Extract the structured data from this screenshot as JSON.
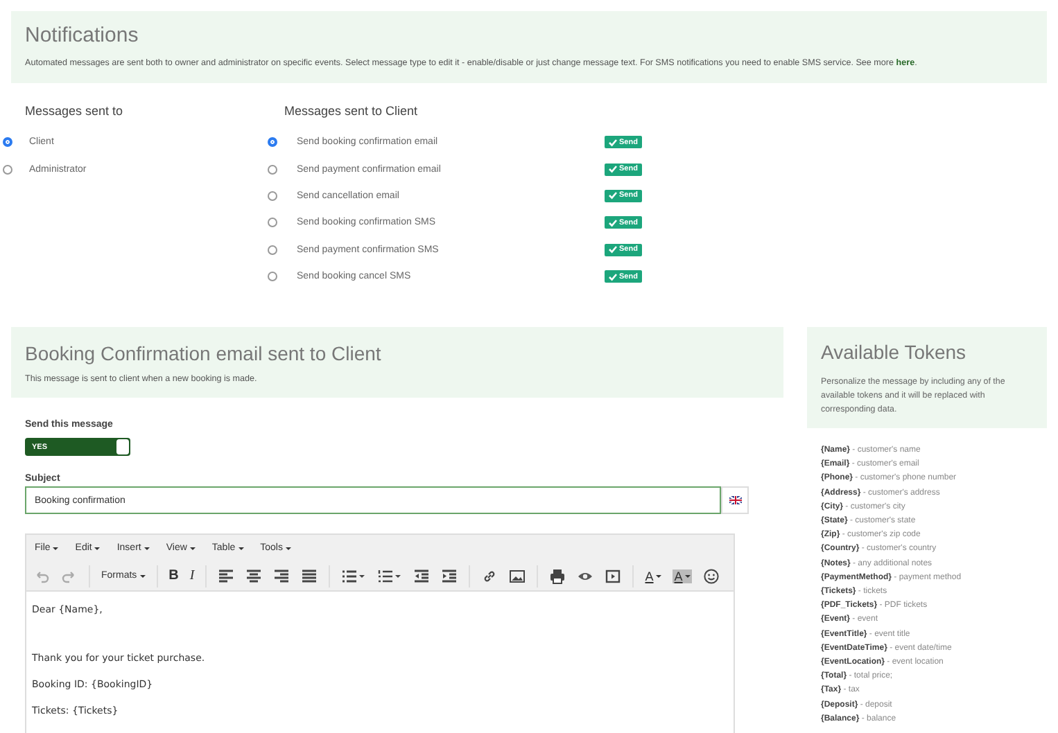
{
  "notifications": {
    "title": "Notifications",
    "description": "Automated messages are sent both to owner and administrator on specific events. Select message type to edit it - enable/disable or just change message text. For SMS notifications you need to enable SMS service. See more ",
    "link": "here",
    "suffix": "."
  },
  "recipients": {
    "heading": "Messages sent to",
    "items": [
      {
        "label": "Client",
        "selected": true
      },
      {
        "label": "Administrator",
        "selected": false
      }
    ]
  },
  "client_messages": {
    "heading": "Messages sent to Client",
    "items": [
      {
        "label": "Send booking confirmation email",
        "selected": true,
        "badge": "Send"
      },
      {
        "label": "Send payment confirmation email",
        "selected": false,
        "badge": "Send"
      },
      {
        "label": "Send cancellation email",
        "selected": false,
        "badge": "Send"
      },
      {
        "label": "Send booking confirmation SMS",
        "selected": false,
        "badge": "Send"
      },
      {
        "label": "Send payment confirmation SMS",
        "selected": false,
        "badge": "Send"
      },
      {
        "label": "Send booking cancel SMS",
        "selected": false,
        "badge": "Send"
      }
    ]
  },
  "editor_panel": {
    "title": "Booking Confirmation email sent to Client",
    "description": "This message is sent to client when a new booking is made."
  },
  "send_toggle": {
    "label": "Send this message",
    "text": "YES",
    "on": true
  },
  "subject": {
    "label": "Subject",
    "value": "Booking confirmation"
  },
  "editor": {
    "menu": [
      "File",
      "Edit",
      "Insert",
      "View",
      "Table",
      "Tools"
    ],
    "toolbar": {
      "formats": "Formats",
      "bold": "B",
      "italic": "I",
      "text_color": "A",
      "background_color": "A"
    },
    "lines": [
      {
        "text": "Dear {Name},",
        "kind": "paragraph"
      },
      {
        "text": "Thank you for your ticket purchase.",
        "kind": "line"
      },
      {
        "text": "Booking ID: {BookingID}",
        "kind": "line"
      },
      {
        "text": "Tickets: {Tickets}",
        "kind": "line"
      }
    ]
  },
  "tokens_panel": {
    "title": "Available Tokens",
    "description": "Personalize the message by including any of the available tokens and it will be replaced with corresponding data."
  },
  "tokens": [
    "**{Name}** - customer's name",
    "**{Email}** - customer's email",
    "**{Phone}** - customer's phone number",
    "**{Address}** - customer's address",
    "**{City}** - customer's city",
    "**{State}** - customer's state",
    "**{Zip}** - customer's zip code",
    "**{Country}** - customer's country",
    "**{Notes}** - any additional notes",
    "**{PaymentMethod}** - payment method",
    "**{Tickets}** - tickets",
    "**{PDF_Tickets}** - PDF tickets",
    "**{Event}** - event",
    "**{EventTitle}** - event title",
    "**{EventDateTime}** - event date/time",
    "**{EventLocation}** - event location",
    "**{Total}** - total price;",
    "**{Tax}** - tax",
    "**{Deposit}** - deposit",
    "**{Balance}** - balance"
  ]
}
